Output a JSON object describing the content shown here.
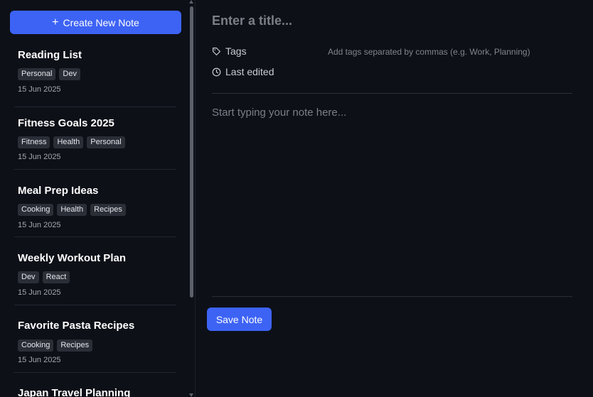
{
  "sidebar": {
    "create_button_icon": "plus-icon",
    "create_button_label": "Create New Note",
    "notes": [
      {
        "title": "Reading List",
        "tags": [
          "Personal",
          "Dev"
        ],
        "date": "15 Jun 2025"
      },
      {
        "title": "Fitness Goals 2025",
        "tags": [
          "Fitness",
          "Health",
          "Personal"
        ],
        "date": "15 Jun 2025"
      },
      {
        "title": "Meal Prep Ideas",
        "tags": [
          "Cooking",
          "Health",
          "Recipes"
        ],
        "date": "15 Jun 2025"
      },
      {
        "title": "Weekly Workout Plan",
        "tags": [
          "Dev",
          "React"
        ],
        "date": "15 Jun 2025"
      },
      {
        "title": "Favorite Pasta Recipes",
        "tags": [
          "Cooking",
          "Recipes"
        ],
        "date": "15 Jun 2025"
      },
      {
        "title": "Japan Travel Planning",
        "tags": [],
        "date": ""
      }
    ]
  },
  "editor": {
    "title_placeholder": "Enter a title...",
    "tags_label": "Tags",
    "tags_icon": "tag-icon",
    "tags_placeholder": "Add tags separated by commas (e.g. Work, Planning)",
    "last_edited_label": "Last edited",
    "last_edited_icon": "clock-icon",
    "body_placeholder": "Start typing your note here...",
    "save_label": "Save Note"
  },
  "colors": {
    "background": "#0d1017",
    "accent": "#3d63f5",
    "tag_bg": "#2a2e37"
  }
}
